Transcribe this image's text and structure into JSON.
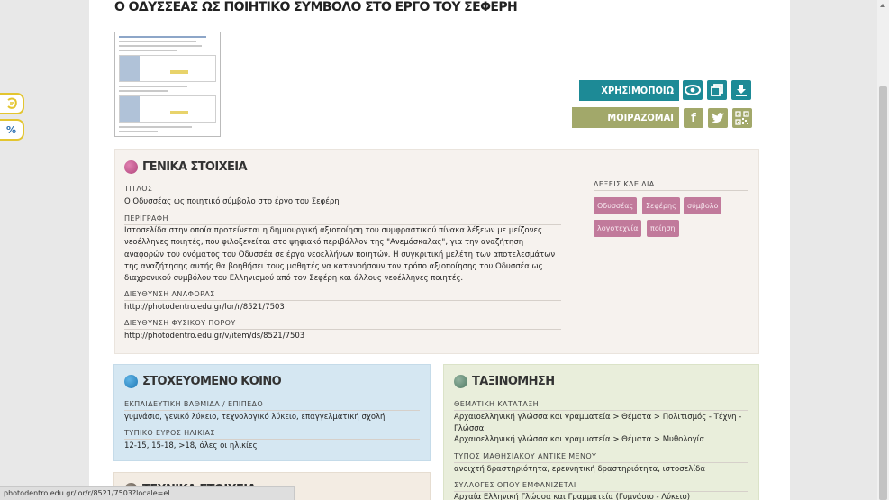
{
  "page_title": "Ο ΟΔΥΣΣΕΑΣ ΩΣ ΠΟΙΗΤΙΚΟ ΣΥΜΒΟΛΟ ΣΤΟ ΕΡΓΟ ΤΟΥ ΣΕΦΕΡΗ",
  "actions": {
    "use_label": "ΧΡΗΣΙΜΟΠΟΙΩ",
    "share_label": "ΜΟΙΡΑΖΟΜΑΙ",
    "facebook_glyph": "f"
  },
  "general": {
    "heading": "ΓΕΝΙΚΑ ΣΤΟΙΧΕΙΑ",
    "title_label": "ΤΙΤΛΟΣ",
    "title_value": "Ο Οδυσσέας ως ποιητικό σύμβολο στο έργο του Σεφέρη",
    "desc_label": "ΠΕΡΙΓΡΑΦΗ",
    "desc_value": "Ιστοσελίδα στην οποία προτείνεται η δημιουργική αξιοποίηση του συμφραστικού πίνακα λέξεων με μείζονες νεοέλληνες ποιητές, που φιλοξενείται στο ψηφιακό περιβάλλον της \"Ανεμόσκαλας\", για την αναζήτηση αναφορών του ονόματος του Οδυσσέα σε έργα νεοελλήνων ποιητών. Η συγκριτική μελέτη των αποτελεσμάτων της αναζήτησης αυτής θα βοηθήσει τους μαθητές να κατανοήσουν τον τρόπο αξιοποίησης του Οδυσσέα ως διαχρονικού συμβόλου του Ελληνισμού από τον Σεφέρη και άλλους νεοέλληνες ποιητές.",
    "ref_label": "ΔΙΕΥΘΥΝΣΗ ΑΝΑΦΟΡΑΣ",
    "ref_value": "http://photodentro.edu.gr/lor/r/8521/7503",
    "phys_label": "ΔΙΕΥΘΥΝΣΗ ΦΥΣΙΚΟΥ ΠΟΡΟΥ",
    "phys_value": "http://photodentro.edu.gr/v/item/ds/8521/7503",
    "keywords_label": "ΛΕΞΕΙΣ ΚΛΕΙΔΙΑ",
    "keywords": [
      "Οδυσσέας",
      "Σεφέρης",
      "σύμβολο",
      "λογοτεχνία",
      "ποίηση"
    ]
  },
  "audience": {
    "heading": "ΣΤΟΧΕΥΟΜΕΝΟ ΚΟΙΝΟ",
    "level_label": "ΕΚΠΑΙΔΕΥΤΙΚΗ ΒΑΘΜΙΔΑ / ΕΠΙΠΕΔΟ",
    "level_value": "γυμνάσιο, γενικό λύκειο, τεχνολογικό λύκειο, επαγγελματική σχολή",
    "age_label": "ΤΥΠΙΚΟ ΕΥΡΟΣ ΗΛΙΚΙΑΣ",
    "age_value": "12-15, 15-18, >18, όλες οι ηλικίες"
  },
  "taxonomy": {
    "heading": "ΤΑΞΙΝΟΜΗΣΗ",
    "subject_label": "ΘΕΜΑΤΙΚΗ ΚΑΤΑΤΑΞΗ",
    "subject_1": "Αρχαιοελληνική γλώσσα και γραμματεία > Θέματα > Πολιτισμός - Τέχνη - Γλώσσα",
    "subject_2": "Αρχαιοελληνική γλώσσα και γραμματεία > Θέματα > Μυθολογία",
    "type_label": "ΤΥΠΟΣ ΜΑΘΗΣΙΑΚΟΥ ΑΝΤΙΚΕΙΜΕΝΟΥ",
    "type_value": "ανοιχτή δραστηριότητα, ερευνητική δραστηριότητα, ιστοσελίδα",
    "collections_label": "ΣΥΛΛΟΓΕΣ ΟΠΟΥ ΕΜΦΑΝΙΖΕΤΑΙ",
    "collections_value": "Αρχαία Ελληνική Γλώσσα και Γραμματεία (Γυμνάσιο - Λύκειο)"
  },
  "technical": {
    "heading": "ΤΕΧΝΙΚΑ ΣΤΟΙΧΕΙΑ"
  },
  "side_tools": {
    "tool2_glyph": "%"
  },
  "status_bar": "photodentro.edu.gr/lor/r/8521/7503?locale=el",
  "colors": {
    "teal": "#1d8a96",
    "olive": "#a2a86a",
    "keyword": "#c17a9b",
    "general_bg": "#f6f2ee",
    "audience_bg": "#d5e7f2",
    "taxonomy_bg": "#e9eedb"
  },
  "icons": {
    "view": "eye-icon",
    "copy": "copy-icon",
    "download": "download-icon",
    "facebook": "facebook-icon",
    "twitter": "twitter-icon",
    "qr": "qr-code-icon"
  }
}
